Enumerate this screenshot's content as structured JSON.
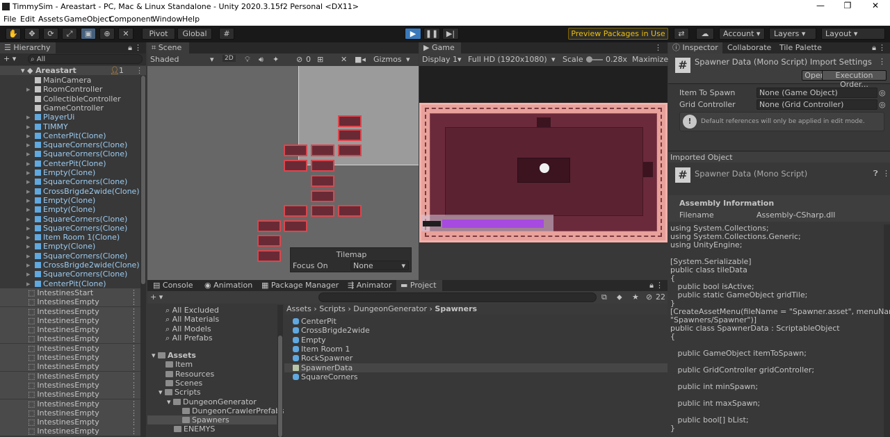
{
  "window": {
    "title": "TimmySim - Areastart - PC, Mac & Linux Standalone - Unity 2020.3.15f2 Personal <DX11>",
    "minimize": "—",
    "maximize": "❐",
    "close": "✕"
  },
  "menu": [
    "File",
    "Edit",
    "Assets",
    "GameObject",
    "Component",
    "Window",
    "Help"
  ],
  "toolbar": {
    "pivot": "Pivot",
    "global": "Global",
    "preview_packages": "Preview Packages in Use ▾",
    "account": "Account",
    "layers": "Layers",
    "layout": "Layout"
  },
  "hierarchy": {
    "tab": "Hierarchy",
    "add": "+ ▾",
    "search_placeholder": "All",
    "scene": "Areastart",
    "scene_badge": "1",
    "items": [
      "MainCamera",
      "RoomController",
      "CollectibleController",
      "GameController",
      "PlayerUi",
      "TIMMY",
      "CenterPit(Clone)",
      "SquareCorners(Clone)",
      "SquareCorners(Clone)",
      "CenterPit(Clone)",
      "Empty(Clone)",
      "SquareCorners(Clone)",
      "CrossBrigde2wide(Clone)",
      "Empty(Clone)",
      "Empty(Clone)",
      "SquareCorners(Clone)",
      "SquareCorners(Clone)",
      "Item Room 1(Clone)",
      "Empty(Clone)",
      "SquareCorners(Clone)",
      "CrossBrigde2wide(Clone)",
      "SquareCorners(Clone)",
      "CenterPit(Clone)"
    ],
    "intestines": [
      "IntestinesStart",
      "IntestinesEmpty",
      "IntestinesEmpty",
      "IntestinesEmpty",
      "IntestinesEmpty",
      "IntestinesEmpty",
      "IntestinesEmpty",
      "IntestinesEmpty",
      "IntestinesEmpty",
      "IntestinesEmpty",
      "IntestinesEmpty",
      "IntestinesEmpty",
      "IntestinesEmpty",
      "IntestinesEmpty",
      "IntestinesEmpty",
      "IntestinesEmpty"
    ]
  },
  "scene": {
    "tab": "Scene",
    "shading": "Shaded",
    "mode2d": "2D",
    "hidden_count": "0",
    "gizmos": "Gizmos",
    "tilemap_title": "Tilemap",
    "focus_label": "Focus On",
    "focus_value": "None"
  },
  "game": {
    "tab": "Game",
    "display": "Display 1",
    "resolution": "Full HD (1920x1080)",
    "scale_label": "Scale",
    "scale_value": "0.28x",
    "maximize": "Maximize"
  },
  "bottom_tabs": [
    "Console",
    "Animation",
    "Package Manager",
    "Animator",
    "Project"
  ],
  "project": {
    "add": "+ ▾",
    "count": "22",
    "favorites": [
      "All Excluded",
      "All Materials",
      "All Models",
      "All Prefabs"
    ],
    "assets_root": "Assets",
    "tree": [
      "Item",
      "Resources",
      "Scenes",
      "Scripts",
      "DungeonGenerator",
      "DungeonCrawlerPrefabs",
      "Spawners",
      "ENEMYS"
    ],
    "breadcrumb": [
      "Assets",
      "Scripts",
      "DungeonGenerator",
      "Spawners"
    ],
    "files": [
      "CenterPit",
      "CrossBrigde2wide",
      "Empty",
      "Item Room 1",
      "RockSpawner",
      "SpawnerData",
      "SquareCorners"
    ]
  },
  "inspector": {
    "tabs": [
      "Inspector",
      "Collaborate",
      "Tile Palette"
    ],
    "header_title": "Spawner Data (Mono Script) Import Settings",
    "open": "Open",
    "execution_order": "Execution Order...",
    "fields": [
      {
        "label": "Item To Spawn",
        "value": "None (Game Object)"
      },
      {
        "label": "Grid Controller",
        "value": "None (Grid Controller)"
      }
    ],
    "help_text": "Default references will only be applied in edit mode.",
    "imported_object": "Imported Object",
    "script_title": "Spawner Data (Mono Script)",
    "assembly_info": "Assembly Information",
    "filename_label": "Filename",
    "filename_value": "Assembly-CSharp.dll",
    "code": "using System.Collections;\nusing System.Collections.Generic;\nusing UnityEngine;\n\n[System.Serializable]\npublic class tileData\n{\n   public bool isActive;\n   public static GameObject gridTile;\n}\n[CreateAssetMenu(fileName = \"Spawner.asset\", menuName =\n\"Spawners/Spawner\")]\npublic class SpawnerData : ScriptableObject\n{\n\n   public GameObject itemToSpawn;\n\n   public GridController gridController;\n\n   public int minSpawn;\n\n   public int maxSpawn;\n\n   public bool[] bList;\n}"
  },
  "colors": {
    "selection": "#2c5d87",
    "accent_play": "#3a79bb",
    "preview_text": "#f0c000",
    "room_floor": "#5b2231",
    "room_wall": "#e8a19b",
    "purple_bar": "#a64ae0"
  }
}
